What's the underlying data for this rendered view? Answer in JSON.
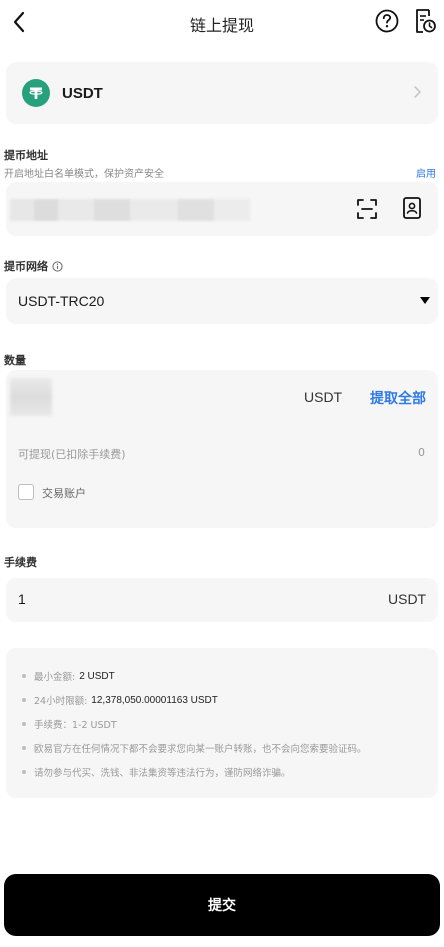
{
  "header": {
    "title": "链上提现",
    "back_icon": "chevron-left-icon",
    "help_icon": "question-circle-icon",
    "history_icon": "history-document-icon"
  },
  "coin": {
    "symbol": "USDT",
    "icon": "tether-icon",
    "icon_color": "#26a17b"
  },
  "address": {
    "label": "提币地址",
    "hint": "开启地址白名单模式，保护资产安全",
    "enable_link": "启用",
    "value": ""
  },
  "network": {
    "label": "提币网络",
    "value": "USDT-TRC20"
  },
  "quantity": {
    "label": "数量",
    "value": "",
    "unit": "USDT",
    "withdraw_all": "提取全部",
    "available_label": "可提现(已扣除手续费)",
    "available_value": "0",
    "trading_account_label": "交易账户",
    "trading_account_checked": false
  },
  "fee": {
    "label": "手续费",
    "value": "1",
    "unit": "USDT"
  },
  "notes": {
    "min_amount_label": "最小金额:",
    "min_amount_value": "2 USDT",
    "daily_limit_label": "24小时限额:",
    "daily_limit_value": "12,378,050.00001163 USDT",
    "fee_line": "手续费：1-2 USDT",
    "warning_1": "欧易官方在任何情况下都不会要求您向某一账户转账，也不会向您索要验证码。",
    "warning_2": "请勿参与代买、洗钱、非法集资等违法行为，谨防网络诈骗。"
  },
  "submit_label": "提交",
  "colors": {
    "accent": "#2f7ae5",
    "card_bg": "#f6f6f6",
    "button_bg": "#000000"
  }
}
